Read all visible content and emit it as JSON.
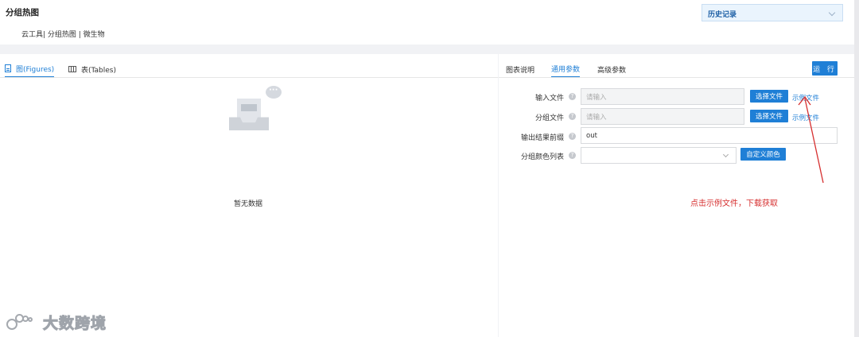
{
  "header": {
    "title": "分组热图",
    "breadcrumb": "云工具| 分组热图 | 微生物",
    "history_label": "历史记录"
  },
  "left": {
    "tabs": [
      {
        "label": "图(Figures)",
        "active": true
      },
      {
        "label": "表(Tables)",
        "active": false
      }
    ],
    "empty_text": "暂无数据"
  },
  "right": {
    "tabs": [
      {
        "label": "图表说明",
        "active": false
      },
      {
        "label": "通用参数",
        "active": true
      },
      {
        "label": "高级参数",
        "active": false
      }
    ],
    "run_label": "运 行",
    "form": {
      "input_file": {
        "label": "输入文件",
        "placeholder": "请输入",
        "button": "选择文件",
        "link": "示例文件"
      },
      "group_file": {
        "label": "分组文件",
        "placeholder": "请输入",
        "button": "选择文件",
        "link": "示例文件"
      },
      "output_prefix": {
        "label": "输出结果前缀",
        "value": "out"
      },
      "group_colors": {
        "label": "分组颜色列表",
        "value": "",
        "button": "自定义颜色"
      }
    }
  },
  "annotation": {
    "text": "点击示例文件，下载获取",
    "color": "#d62f2f"
  },
  "watermark": {
    "text": "大数跨境"
  },
  "colors": {
    "accent": "#1f7fd6",
    "history_bg": "#eaf4fd"
  }
}
